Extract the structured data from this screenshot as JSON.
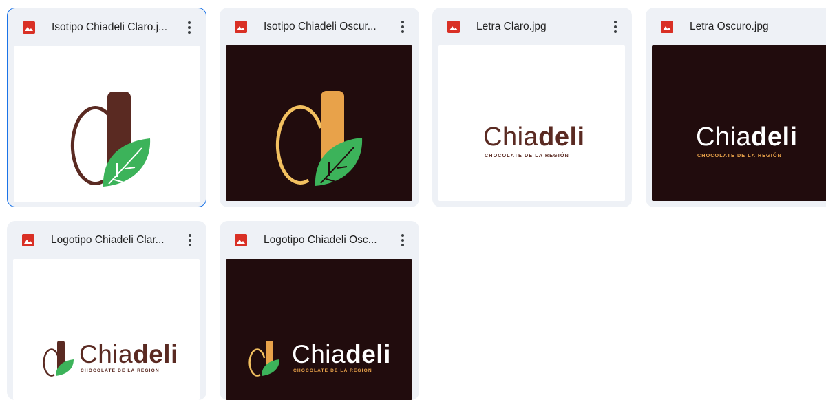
{
  "files": [
    {
      "name": "Isotipo Chiadeli Claro.j...",
      "type_icon": "image-file-icon",
      "selected": true
    },
    {
      "name": "Isotipo Chiadeli Oscur...",
      "type_icon": "image-file-icon"
    },
    {
      "name": "Letra Claro.jpg",
      "type_icon": "image-file-icon"
    },
    {
      "name": "Letra Oscuro.jpg",
      "type_icon": "image-file-icon"
    },
    {
      "name": "Logotipo Chiadeli Clar...",
      "type_icon": "image-file-icon"
    },
    {
      "name": "Logotipo Chiadeli Osc...",
      "type_icon": "image-file-icon"
    }
  ],
  "brand": {
    "word_thin": "Chia",
    "word_bold": "deli",
    "tagline": "CHOCOLATE DE LA REGIÓN"
  },
  "colors": {
    "selected_border": "#1a73e8",
    "card_bg": "#eef1f6",
    "dark_bg": "#210c0d",
    "chocolate": "#5a2a22",
    "light_bar": "#e8a24a",
    "light_ring": "#f2c060",
    "leaf_green": "#3cb35a",
    "image_icon_red": "#d93025"
  }
}
